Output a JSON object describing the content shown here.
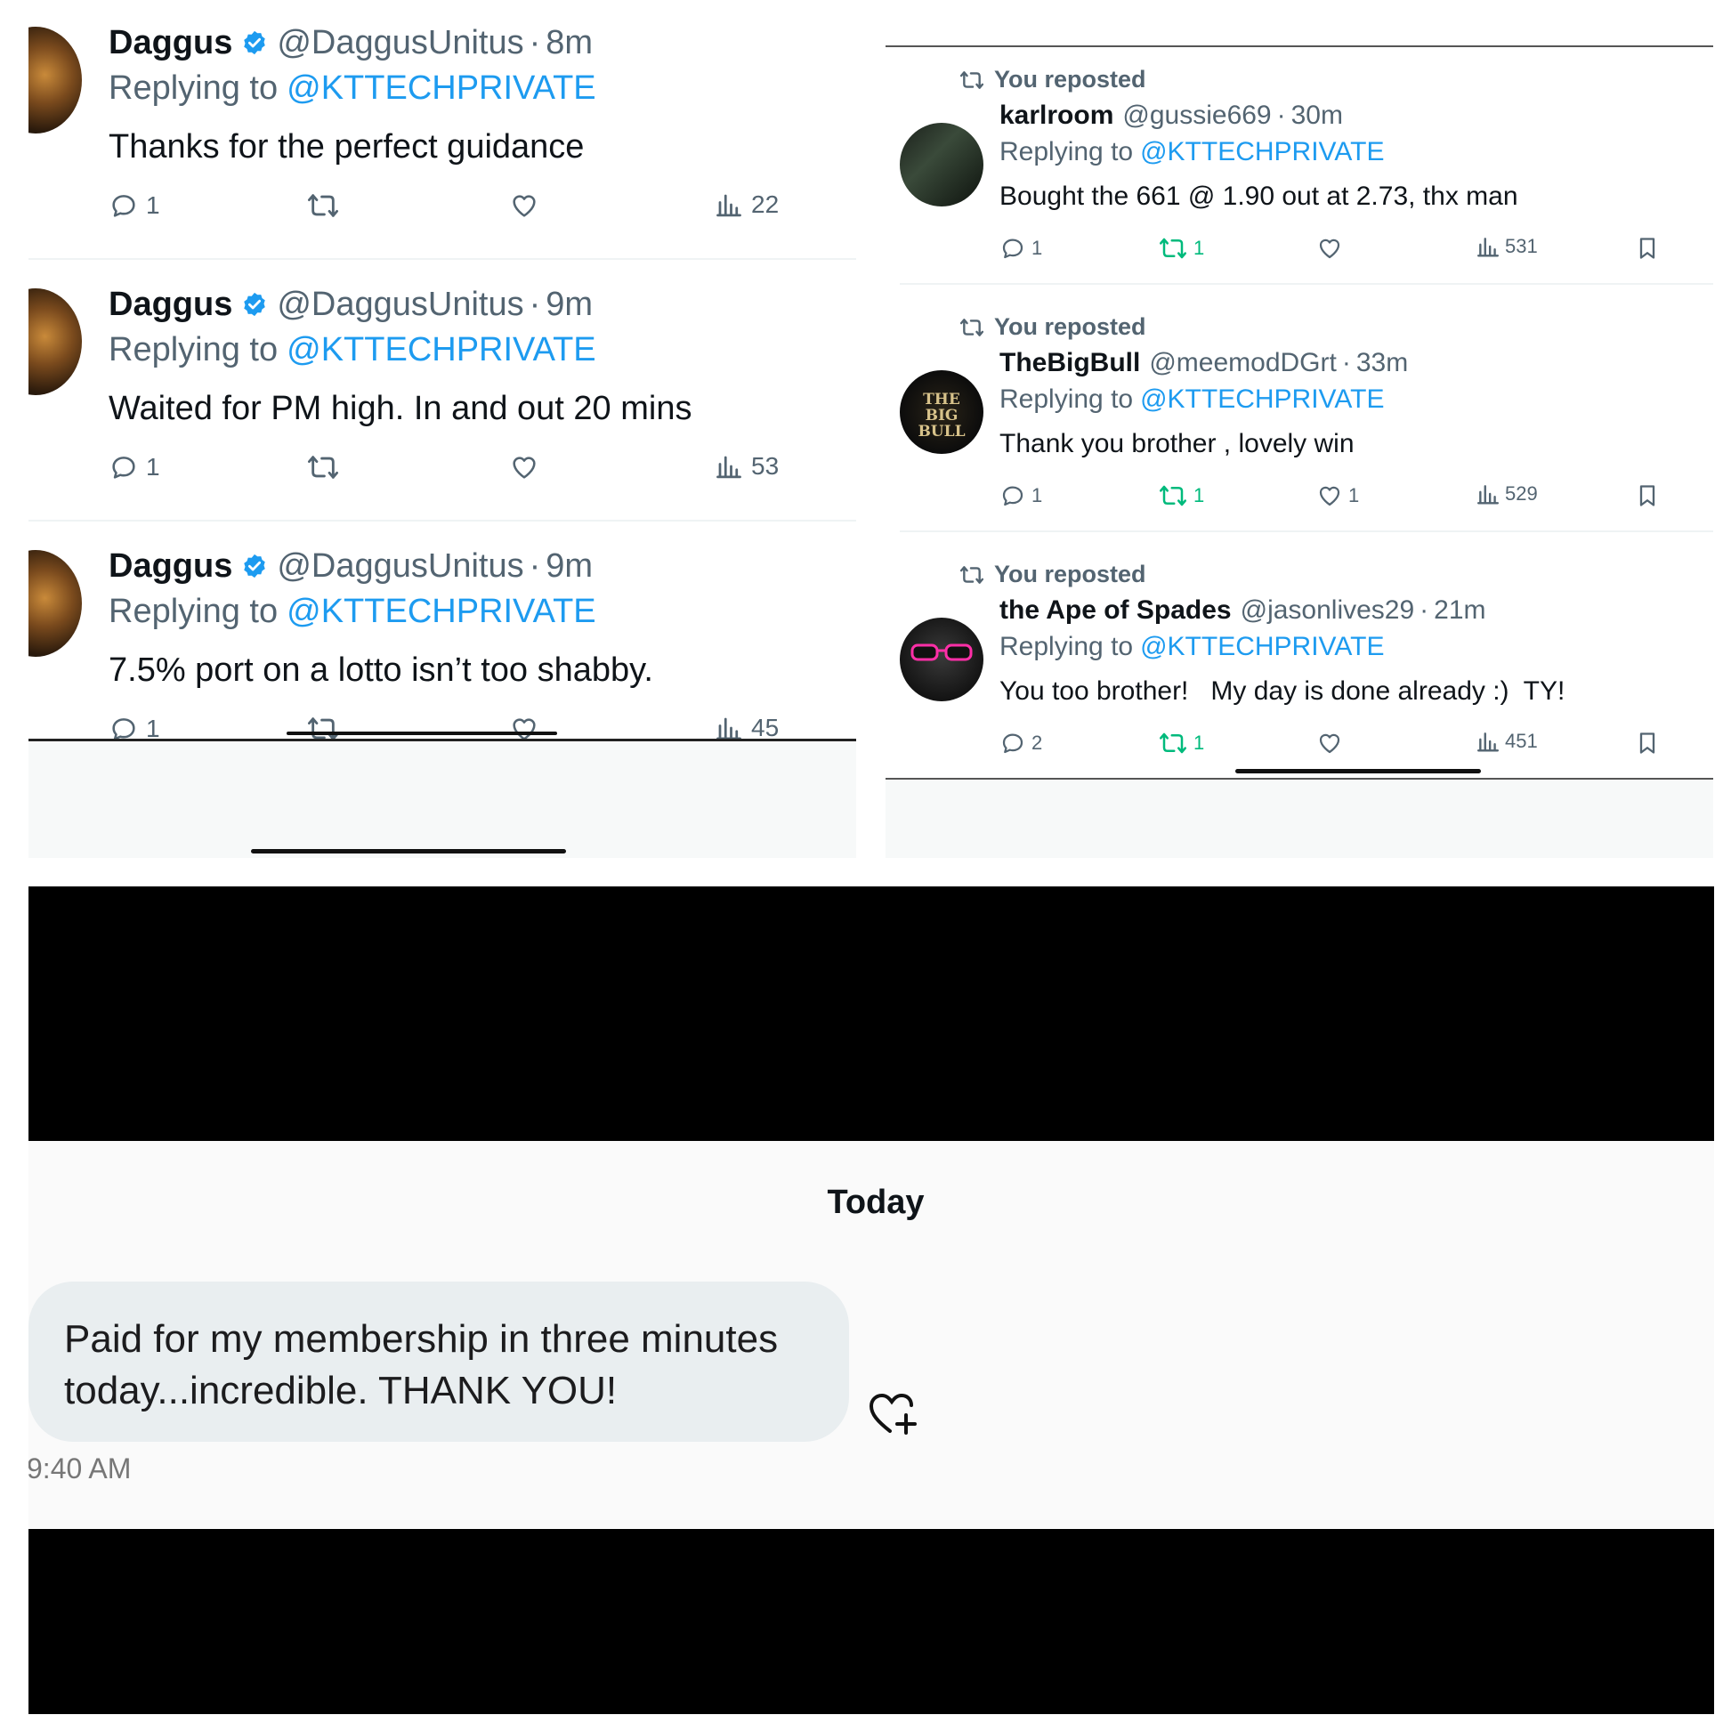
{
  "left_tweets": [
    {
      "name": "Daggus",
      "handle": "@DaggusUnitus",
      "dot": "·",
      "time": "8m",
      "replying_prefix": "Replying to",
      "replying_to": "@KTTECHPRIVATE",
      "text": "Thanks for the perfect guidance",
      "replies": "1",
      "reposts": "",
      "likes": "",
      "views": "22"
    },
    {
      "name": "Daggus",
      "handle": "@DaggusUnitus",
      "dot": "·",
      "time": "9m",
      "replying_prefix": "Replying to",
      "replying_to": "@KTTECHPRIVATE",
      "text": "Waited for PM high. In and out 20 mins",
      "replies": "1",
      "reposts": "",
      "likes": "",
      "views": "53"
    },
    {
      "name": "Daggus",
      "handle": "@DaggusUnitus",
      "dot": "·",
      "time": "9m",
      "replying_prefix": "Replying to",
      "replying_to": "@KTTECHPRIVATE",
      "text": "7.5% port on a lotto isn’t too shabby.",
      "replies": "1",
      "reposts": "",
      "likes": "",
      "views": "45"
    }
  ],
  "right_tweets": [
    {
      "repost_label": "You reposted",
      "name": "karlroom",
      "handle": "@gussie669",
      "dot": "·",
      "time": "30m",
      "replying_prefix": "Replying to",
      "replying_to": "@KTTECHPRIVATE",
      "text": "Bought the 661 @ 1.90 out at 2.73, thx man",
      "replies": "1",
      "reposts": "1",
      "likes": "",
      "views": "531"
    },
    {
      "repost_label": "You reposted",
      "name": "TheBigBull",
      "handle": "@meemodDGrt",
      "dot": "·",
      "time": "33m",
      "replying_prefix": "Replying to",
      "replying_to": "@KTTECHPRIVATE",
      "text": "Thank you brother , lovely win",
      "replies": "1",
      "reposts": "1",
      "likes": "1",
      "views": "529",
      "avatar_text": "THE BIG BULL"
    },
    {
      "repost_label": "You reposted",
      "name": "the Ape of Spades",
      "handle": "@jasonlives29",
      "dot": "·",
      "time": "21m",
      "replying_prefix": "Replying to",
      "replying_to": "@KTTECHPRIVATE",
      "text": "You too brother!   My day is done already :)  TY!",
      "replies": "2",
      "reposts": "1",
      "likes": "",
      "views": "451"
    }
  ],
  "dm": {
    "date_label": "Today",
    "message": "Paid for my membership in three minutes today...incredible.  THANK YOU!",
    "time": "9:40 AM"
  },
  "colors": {
    "accent": "#1d9bf0",
    "repost_green": "#00ba7c",
    "muted": "#536471",
    "verified": "#1d9bf0"
  }
}
